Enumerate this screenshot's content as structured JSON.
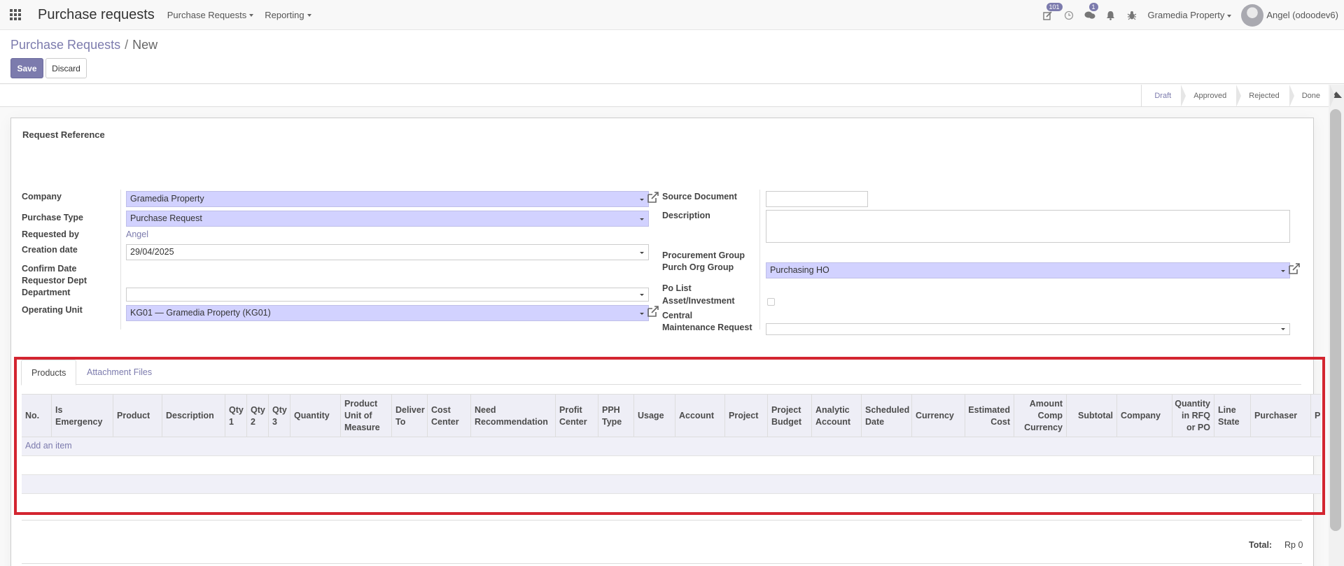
{
  "navbar": {
    "app_title": "Purchase requests",
    "menus": [
      "Purchase Requests",
      "Reporting"
    ],
    "activity_badge": "101",
    "messages_badge": "1",
    "company": "Gramedia Property",
    "user": "Angel (odoodev6)"
  },
  "control_panel": {
    "breadcrumb_parent": "Purchase Requests",
    "breadcrumb_separator": "/",
    "breadcrumb_current": "New",
    "save_label": "Save",
    "discard_label": "Discard"
  },
  "statusbar": {
    "stages": [
      "Draft",
      "Approved",
      "Rejected",
      "Done"
    ],
    "active_stage": "Draft"
  },
  "form": {
    "ref_label": "Request Reference",
    "left": {
      "company_label": "Company",
      "company_value": "Gramedia Property",
      "purchase_type_label": "Purchase Type",
      "purchase_type_value": "Purchase Request",
      "requested_by_label": "Requested by",
      "requested_by_value": "Angel",
      "creation_date_label": "Creation date",
      "creation_date_value": "29/04/2025",
      "confirm_date_label": "Confirm Date",
      "requestor_dept_label": "Requestor Dept",
      "department_label": "Department",
      "department_value": "",
      "operating_unit_label": "Operating Unit",
      "operating_unit_value": "KG01 — Gramedia Property (KG01)"
    },
    "right": {
      "source_document_label": "Source Document",
      "source_document_value": "",
      "description_label": "Description",
      "description_value": "",
      "procurement_group_label": "Procurement Group",
      "purch_org_group_label": "Purch Org Group",
      "purch_org_group_value": "Purchasing HO",
      "po_list_label": "Po List",
      "asset_investment_label": "Asset/Investment",
      "central_label": "Central",
      "maintenance_request_label": "Maintenance Request",
      "maintenance_request_value": ""
    }
  },
  "tabs": [
    "Products",
    "Attachment Files"
  ],
  "table": {
    "columns": [
      "No.",
      "Is Emergency",
      "Product",
      "Description",
      "Qty 1",
      "Qty 2",
      "Qty 3",
      "Quantity",
      "Product Unit of Measure",
      "Deliver To",
      "Cost Center",
      "Need Recommendation",
      "Profit Center",
      "PPH Type",
      "Usage",
      "Account",
      "Project",
      "Project Budget",
      "Analytic Account",
      "Scheduled Date",
      "Currency",
      "Estimated Cost",
      "Amount Comp Currency",
      "Subtotal",
      "Company",
      "Quantity in RFQ or PO",
      "Line State",
      "Purchaser",
      "P S"
    ],
    "add_item": "Add an item"
  },
  "totals": {
    "label": "Total:",
    "value": "Rp 0"
  },
  "colors": {
    "primary": "#7c7bad",
    "required_field": "#d2d2ff",
    "highlight": "#d32530"
  }
}
